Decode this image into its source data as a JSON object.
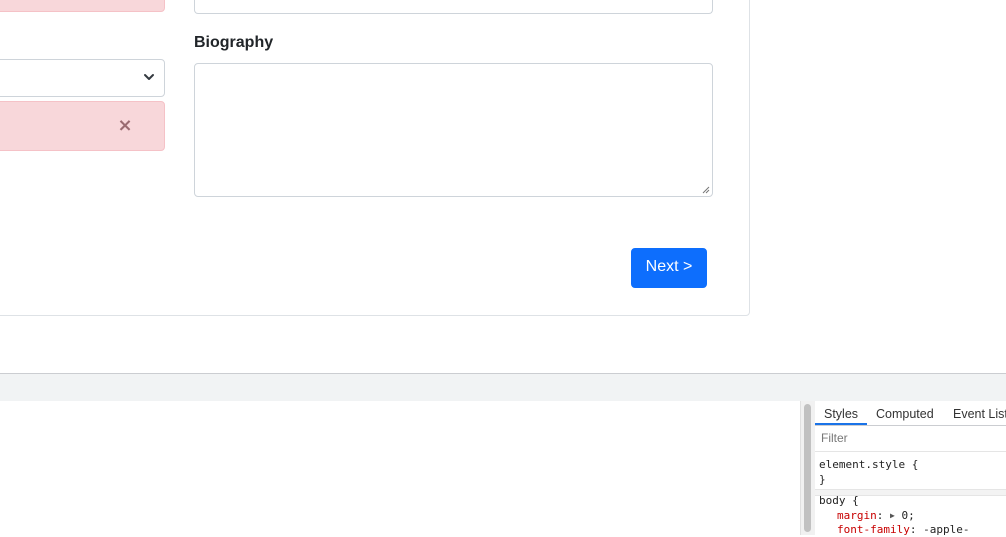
{
  "form": {
    "biography_label": "Biography",
    "biography_value": "",
    "select_value": "",
    "alert_close_glyph": "×",
    "next_button": "Next >"
  },
  "devtools": {
    "tabs": [
      "Styles",
      "Computed",
      "Event List"
    ],
    "active_tab": "Styles",
    "filter_placeholder": "Filter",
    "element_style_open": "element.style {",
    "element_style_close": "}",
    "body_selector": "body {",
    "body_prop1_name": "margin",
    "body_prop1_value": "0;",
    "body_prop2_name": "font-family",
    "body_prop2_value": "-apple-"
  },
  "colors": {
    "primary": "#0d6efd",
    "alert_bg": "#f8d7da",
    "devtools_accent": "#1a73e8"
  }
}
